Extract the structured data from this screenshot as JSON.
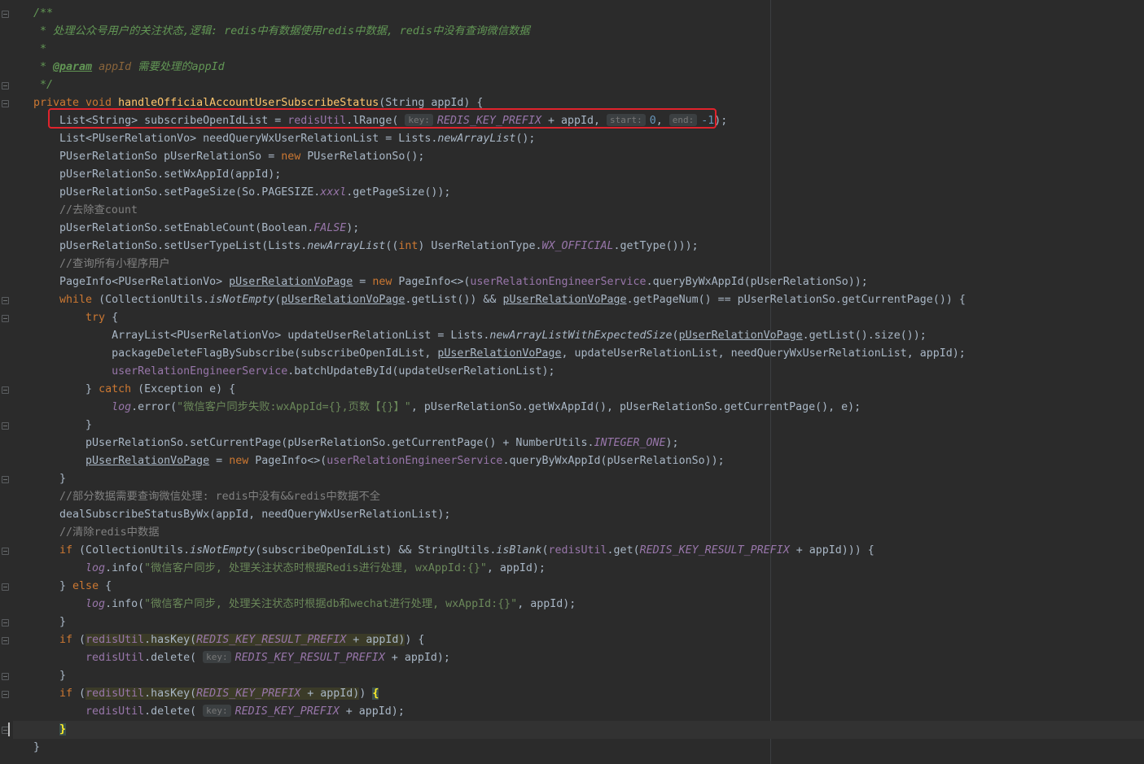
{
  "colors": {
    "background": "#2b2b2b",
    "keyword": "#cc7832",
    "method_decl": "#ffc66d",
    "field": "#9876aa",
    "string": "#6a8759",
    "number": "#6897bb",
    "doc_comment": "#629755",
    "line_comment": "#808080",
    "highlight_box": "#e0232c"
  },
  "icons": [
    "fold-marker-icon",
    "text-caret"
  ],
  "code": {
    "l1": "/**",
    "l2": " * 处理公众号用户的关注状态,逻辑: redis中有数据使用redis中数据, redis中没有查询微信数据",
    "l3": " *",
    "l4a": " * ",
    "l4tag": "@param",
    "l4b": " ",
    "l4pn": "appId",
    "l4c": " 需要处理的appId",
    "l5": " */",
    "l6kw": "private void ",
    "l6fn": "handleOfficialAccountUserSubscribeStatus",
    "l6a": "(String appId) {",
    "l7a": "    List<String> subscribeOpenIdList = ",
    "l7f": "redisUtil",
    "l7b": ".lRange( ",
    "l7h1": "key:",
    "l7s": "REDIS_KEY_PREFIX",
    "l7c": " + appId, ",
    "l7h2": "start:",
    "l7n1": "0",
    "l7d": ", ",
    "l7h3": "end:",
    "l7n2": "-1",
    "l7e": ");",
    "l8a": "    List<PUserRelationVo> needQueryWxUserRelationList = Lists.",
    "l8i": "newArrayList",
    "l8b": "();",
    "l9a": "    PUserRelationSo pUserRelationSo = ",
    "l9k": "new",
    "l9b": " PUserRelationSo();",
    "l10": "    pUserRelationSo.setWxAppId(appId);",
    "l11a": "    pUserRelationSo.setPageSize(So.PAGESIZE.",
    "l11f": "xxxl",
    "l11b": ".getPageSize());",
    "l12": "    //去除查count",
    "l13a": "    pUserRelationSo.setEnableCount(Boolean.",
    "l13f": "FALSE",
    "l13b": ");",
    "l14a": "    pUserRelationSo.setUserTypeList(Lists.",
    "l14i": "newArrayList",
    "l14b": "((",
    "l14k": "int",
    "l14c": ") UserRelationType.",
    "l14f": "WX_OFFICIAL",
    "l14d": ".getType()));",
    "l15": "    //查询所有小程序用户",
    "l16a": "    PageInfo<PUserRelationVo> ",
    "l16u": "pUserRelationVoPage",
    "l16b": " = ",
    "l16k": "new",
    "l16c": " PageInfo<>(",
    "l16f": "userRelationEngineerService",
    "l16d": ".queryByWxAppId(pUserRelationSo));",
    "l17k": "    while",
    "l17a": " (CollectionUtils.",
    "l17i": "isNotEmpty",
    "l17b": "(",
    "l17u1": "pUserRelationVoPage",
    "l17c": ".getList()) && ",
    "l17u2": "pUserRelationVoPage",
    "l17d": ".getPageNum() == pUserRelationSo.getCurrentPage()) {",
    "l18k": "        try",
    "l18a": " {",
    "l19a": "            ArrayList<PUserRelationVo> updateUserRelationList = Lists.",
    "l19i": "newArrayListWithExpectedSize",
    "l19b": "(",
    "l19u": "pUserRelationVoPage",
    "l19c": ".getList().size());",
    "l20a": "            packageDeleteFlagBySubscribe(subscribeOpenIdList, ",
    "l20u": "pUserRelationVoPage",
    "l20b": ", updateUserRelationList, needQueryWxUserRelationList, appId);",
    "l21a": "            ",
    "l21f": "userRelationEngineerService",
    "l21b": ".batchUpdateById(updateUserRelationList);",
    "l22a": "        } ",
    "l22k": "catch",
    "l22b": " (Exception e) {",
    "l23a": "            ",
    "l23f": "log",
    "l23b": ".error(",
    "l23s": "\"微信客户同步失败:wxAppId={},页数【{}】\"",
    "l23c": ", pUserRelationSo.getWxAppId(), pUserRelationSo.getCurrentPage(), e);",
    "l24": "        }",
    "l25a": "        pUserRelationSo.setCurrentPage(pUserRelationSo.getCurrentPage() + NumberUtils.",
    "l25f": "INTEGER_ONE",
    "l25b": ");",
    "l26a": "        ",
    "l26u": "pUserRelationVoPage",
    "l26b": " = ",
    "l26k": "new",
    "l26c": " PageInfo<>(",
    "l26f": "userRelationEngineerService",
    "l26d": ".queryByWxAppId(pUserRelationSo));",
    "l27": "    }",
    "l28": "    //部分数据需要查询微信处理: redis中没有&&redis中数据不全",
    "l29": "    dealSubscribeStatusByWx(appId, needQueryWxUserRelationList);",
    "l30": "    //清除redis中数据",
    "l31k": "    if",
    "l31a": " (CollectionUtils.",
    "l31i": "isNotEmpty",
    "l31b": "(subscribeOpenIdList) && StringUtils.",
    "l31i2": "isBlank",
    "l31c": "(",
    "l31f": "redisUtil",
    "l31d": ".get(",
    "l31s": "REDIS_KEY_RESULT_PREFIX",
    "l31e": " + appId))) {",
    "l32a": "        ",
    "l32f": "log",
    "l32b": ".info(",
    "l32s": "\"微信客户同步, 处理关注状态时根据Redis进行处理, wxAppId:{}\"",
    "l32c": ", appId);",
    "l33a": "    } ",
    "l33k": "else",
    "l33b": " {",
    "l34a": "        ",
    "l34f": "log",
    "l34b": ".info(",
    "l34s": "\"微信客户同步, 处理关注状态时根据db和wechat进行处理, wxAppId:{}\"",
    "l34c": ", appId);",
    "l35": "    }",
    "l36k": "    if",
    "l36a": " (",
    "l36f": "redisUtil",
    "l36b": ".hasKey(",
    "l36s": "REDIS_KEY_RESULT_PREFIX",
    "l36c": " + appId)",
    "l36d": ") {",
    "l37a": "        ",
    "l37f": "redisUtil",
    "l37b": ".delete( ",
    "l37h": "key:",
    "l37s": "REDIS_KEY_RESULT_PREFIX",
    "l37c": " + appId);",
    "l38": "    }",
    "l39k": "    if",
    "l39a": " (",
    "l39f": "redisUtil",
    "l39b": ".hasKey(",
    "l39s": "REDIS_KEY_PREFIX",
    "l39c": " + appId)",
    "l39d": ") ",
    "l39br": "{",
    "l40a": "        ",
    "l40f": "redisUtil",
    "l40b": ".delete( ",
    "l40h": "key:",
    "l40s": "REDIS_KEY_PREFIX",
    "l40c": " + appId);",
    "l41a": "    ",
    "l41br": "}",
    "l42": "}"
  }
}
